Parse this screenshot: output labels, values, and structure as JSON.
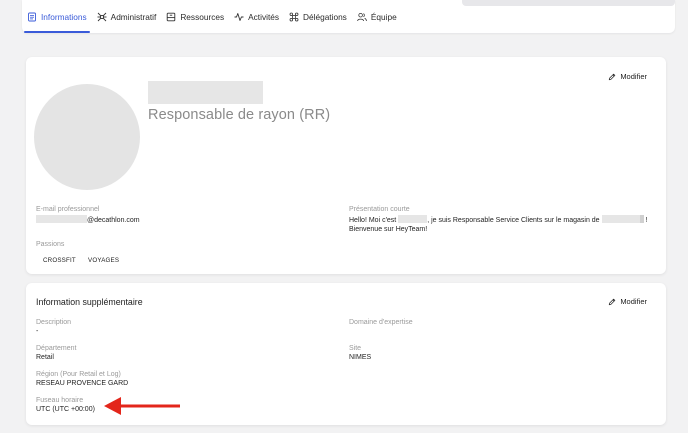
{
  "tabs": [
    {
      "label": "Informations",
      "icon": "document-icon",
      "active": true
    },
    {
      "label": "Administratif",
      "icon": "network-icon",
      "active": false
    },
    {
      "label": "Ressources",
      "icon": "box-icon",
      "active": false
    },
    {
      "label": "Activités",
      "icon": "activity-icon",
      "active": false
    },
    {
      "label": "Délégations",
      "icon": "command-icon",
      "active": false
    },
    {
      "label": "Équipe",
      "icon": "team-icon",
      "active": false
    }
  ],
  "profile": {
    "job_title": "Responsable de rayon (RR)",
    "edit_label": "Modifier",
    "email_label": "E-mail professionnel",
    "email_value": "@decathlon.com",
    "passions_label": "Passions",
    "passions": [
      "CROSSFIT",
      "VOYAGES"
    ],
    "presentation_label": "Présentation courte",
    "presentation_part1": "Hello! Moi c'est",
    "presentation_part2": ", je suis Responsable Service Clients sur le magasin de",
    "presentation_part3": "!",
    "presentation_line2": "Bienvenue sur HeyTeam!"
  },
  "extra": {
    "title": "Information supplémentaire",
    "edit_label": "Modifier",
    "description_label": "Description",
    "description_value": "-",
    "expertise_label": "Domaine d'expertise",
    "department_label": "Département",
    "department_value": "Retail",
    "site_label": "Site",
    "site_value": "NIMES",
    "region_label": "Région (Pour Retail et Log)",
    "region_value": "RESEAU PROVENCE GARD",
    "timezone_label": "Fuseau horaire",
    "timezone_value": "UTC (UTC +00:00)"
  },
  "colors": {
    "accent": "#3a5bd9",
    "arrow": "#e3261b"
  }
}
